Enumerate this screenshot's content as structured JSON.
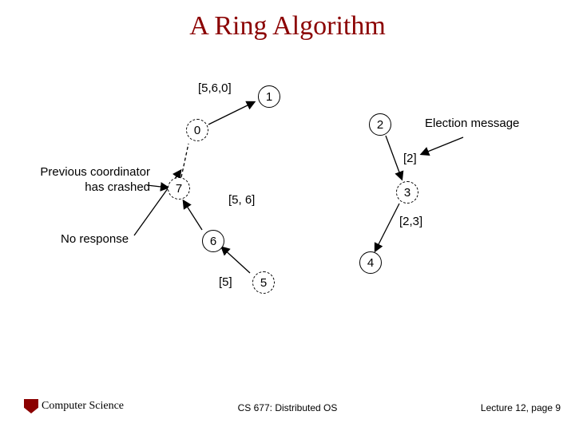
{
  "title": "A Ring Algorithm",
  "annotations": {
    "prev_crashed_line1": "Previous coordinator",
    "prev_crashed_line2": "has crashed",
    "no_response": "No response",
    "election_msg": "Election message"
  },
  "nodes": {
    "n0": "0",
    "n1": "1",
    "n2": "2",
    "n3": "3",
    "n4": "4",
    "n5": "5",
    "n6": "6",
    "n7": "7"
  },
  "edge_labels": {
    "e560": "[5,6,0]",
    "e56": "[5, 6]",
    "e5": "[5]",
    "e2": "[2]",
    "e23": "[2,3]"
  },
  "footer": {
    "left": "Computer Science",
    "center": "CS 677: Distributed OS",
    "right": "Lecture 12, page 9"
  }
}
